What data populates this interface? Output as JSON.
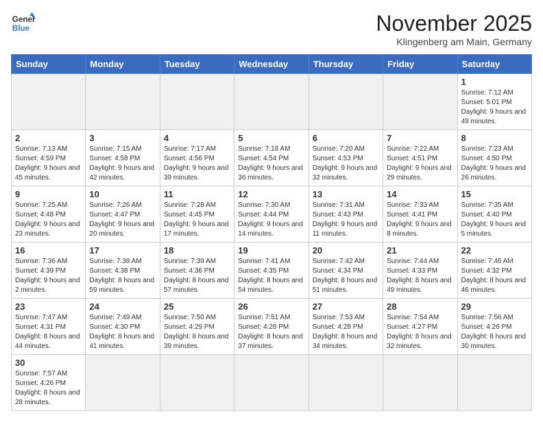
{
  "logo": {
    "line1": "General",
    "line2": "Blue"
  },
  "title": "November 2025",
  "subtitle": "Klingenberg am Main, Germany",
  "days_of_week": [
    "Sunday",
    "Monday",
    "Tuesday",
    "Wednesday",
    "Thursday",
    "Friday",
    "Saturday"
  ],
  "weeks": [
    [
      {
        "day": "",
        "info": ""
      },
      {
        "day": "",
        "info": ""
      },
      {
        "day": "",
        "info": ""
      },
      {
        "day": "",
        "info": ""
      },
      {
        "day": "",
        "info": ""
      },
      {
        "day": "",
        "info": ""
      },
      {
        "day": "1",
        "info": "Sunrise: 7:12 AM\nSunset: 5:01 PM\nDaylight: 9 hours and 49 minutes."
      }
    ],
    [
      {
        "day": "2",
        "info": "Sunrise: 7:13 AM\nSunset: 4:59 PM\nDaylight: 9 hours and 45 minutes."
      },
      {
        "day": "3",
        "info": "Sunrise: 7:15 AM\nSunset: 4:58 PM\nDaylight: 9 hours and 42 minutes."
      },
      {
        "day": "4",
        "info": "Sunrise: 7:17 AM\nSunset: 4:56 PM\nDaylight: 9 hours and 39 minutes."
      },
      {
        "day": "5",
        "info": "Sunrise: 7:18 AM\nSunset: 4:54 PM\nDaylight: 9 hours and 36 minutes."
      },
      {
        "day": "6",
        "info": "Sunrise: 7:20 AM\nSunset: 4:53 PM\nDaylight: 9 hours and 32 minutes."
      },
      {
        "day": "7",
        "info": "Sunrise: 7:22 AM\nSunset: 4:51 PM\nDaylight: 9 hours and 29 minutes."
      },
      {
        "day": "8",
        "info": "Sunrise: 7:23 AM\nSunset: 4:50 PM\nDaylight: 9 hours and 26 minutes."
      }
    ],
    [
      {
        "day": "9",
        "info": "Sunrise: 7:25 AM\nSunset: 4:48 PM\nDaylight: 9 hours and 23 minutes."
      },
      {
        "day": "10",
        "info": "Sunrise: 7:26 AM\nSunset: 4:47 PM\nDaylight: 9 hours and 20 minutes."
      },
      {
        "day": "11",
        "info": "Sunrise: 7:28 AM\nSunset: 4:45 PM\nDaylight: 9 hours and 17 minutes."
      },
      {
        "day": "12",
        "info": "Sunrise: 7:30 AM\nSunset: 4:44 PM\nDaylight: 9 hours and 14 minutes."
      },
      {
        "day": "13",
        "info": "Sunrise: 7:31 AM\nSunset: 4:43 PM\nDaylight: 9 hours and 11 minutes."
      },
      {
        "day": "14",
        "info": "Sunrise: 7:33 AM\nSunset: 4:41 PM\nDaylight: 9 hours and 8 minutes."
      },
      {
        "day": "15",
        "info": "Sunrise: 7:35 AM\nSunset: 4:40 PM\nDaylight: 9 hours and 5 minutes."
      }
    ],
    [
      {
        "day": "16",
        "info": "Sunrise: 7:36 AM\nSunset: 4:39 PM\nDaylight: 9 hours and 2 minutes."
      },
      {
        "day": "17",
        "info": "Sunrise: 7:38 AM\nSunset: 4:38 PM\nDaylight: 8 hours and 59 minutes."
      },
      {
        "day": "18",
        "info": "Sunrise: 7:39 AM\nSunset: 4:36 PM\nDaylight: 8 hours and 57 minutes."
      },
      {
        "day": "19",
        "info": "Sunrise: 7:41 AM\nSunset: 4:35 PM\nDaylight: 8 hours and 54 minutes."
      },
      {
        "day": "20",
        "info": "Sunrise: 7:42 AM\nSunset: 4:34 PM\nDaylight: 8 hours and 51 minutes."
      },
      {
        "day": "21",
        "info": "Sunrise: 7:44 AM\nSunset: 4:33 PM\nDaylight: 8 hours and 49 minutes."
      },
      {
        "day": "22",
        "info": "Sunrise: 7:46 AM\nSunset: 4:32 PM\nDaylight: 8 hours and 46 minutes."
      }
    ],
    [
      {
        "day": "23",
        "info": "Sunrise: 7:47 AM\nSunset: 4:31 PM\nDaylight: 8 hours and 44 minutes."
      },
      {
        "day": "24",
        "info": "Sunrise: 7:49 AM\nSunset: 4:30 PM\nDaylight: 8 hours and 41 minutes."
      },
      {
        "day": "25",
        "info": "Sunrise: 7:50 AM\nSunset: 4:29 PM\nDaylight: 8 hours and 39 minutes."
      },
      {
        "day": "26",
        "info": "Sunrise: 7:51 AM\nSunset: 4:28 PM\nDaylight: 8 hours and 37 minutes."
      },
      {
        "day": "27",
        "info": "Sunrise: 7:53 AM\nSunset: 4:28 PM\nDaylight: 8 hours and 34 minutes."
      },
      {
        "day": "28",
        "info": "Sunrise: 7:54 AM\nSunset: 4:27 PM\nDaylight: 8 hours and 32 minutes."
      },
      {
        "day": "29",
        "info": "Sunrise: 7:56 AM\nSunset: 4:26 PM\nDaylight: 8 hours and 30 minutes."
      }
    ],
    [
      {
        "day": "30",
        "info": "Sunrise: 7:57 AM\nSunset: 4:26 PM\nDaylight: 8 hours and 28 minutes."
      },
      {
        "day": "",
        "info": ""
      },
      {
        "day": "",
        "info": ""
      },
      {
        "day": "",
        "info": ""
      },
      {
        "day": "",
        "info": ""
      },
      {
        "day": "",
        "info": ""
      },
      {
        "day": "",
        "info": ""
      }
    ]
  ]
}
